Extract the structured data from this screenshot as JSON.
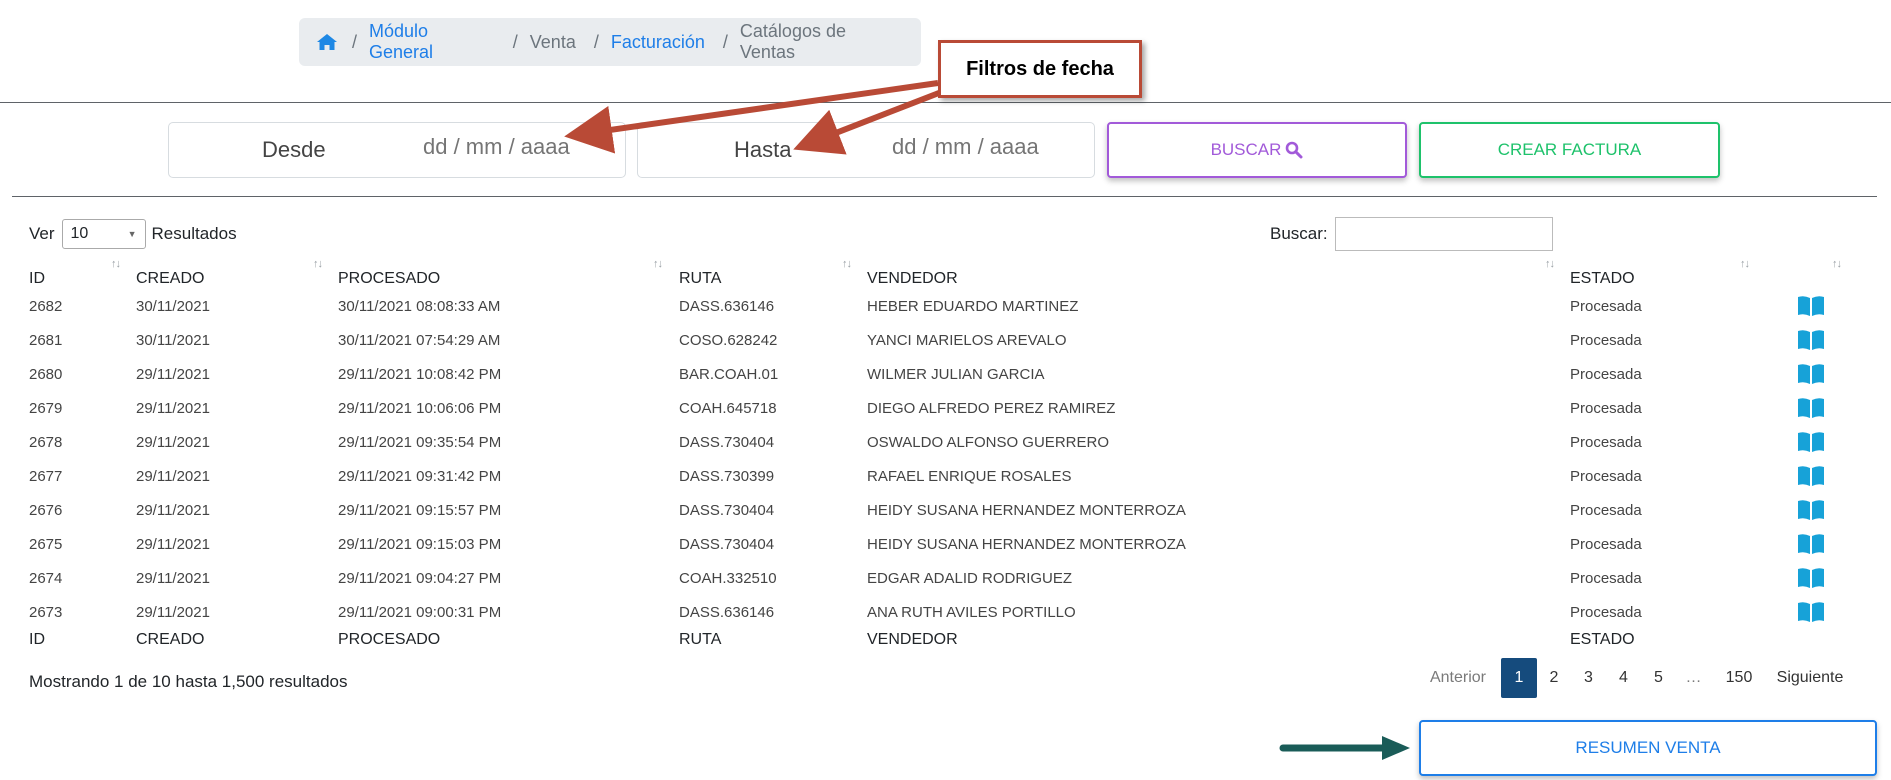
{
  "breadcrumb": {
    "items": [
      {
        "label": "Módulo General",
        "type": "link"
      },
      {
        "label": "Venta",
        "type": "muted"
      },
      {
        "label": "Facturación",
        "type": "link"
      },
      {
        "label": "Catálogos de Ventas",
        "type": "muted"
      }
    ],
    "separator": "/"
  },
  "annotation": {
    "callout_text": "Filtros de fecha",
    "color": "#b94a36",
    "arrow2_color": "#1a5c58"
  },
  "filters": {
    "desde_label": "Desde",
    "desde_placeholder": "dd / mm / aaaa",
    "hasta_label": "Hasta",
    "hasta_placeholder": "dd / mm / aaaa",
    "buscar_button": "BUSCAR",
    "crear_button": "CREAR FACTURA"
  },
  "table_controls": {
    "ver_label": "Ver",
    "page_size": "10",
    "resultados_label": "Resultados",
    "search_label": "Buscar:",
    "search_value": ""
  },
  "table": {
    "headers": [
      "ID",
      "CREADO",
      "PROCESADO",
      "RUTA",
      "VENDEDOR",
      "ESTADO"
    ],
    "rows": [
      {
        "id": "2682",
        "creado": "30/11/2021",
        "procesado": "30/11/2021 08:08:33 AM",
        "ruta": "DASS.636146",
        "vendedor": "HEBER EDUARDO MARTINEZ",
        "estado": "Procesada"
      },
      {
        "id": "2681",
        "creado": "30/11/2021",
        "procesado": "30/11/2021 07:54:29 AM",
        "ruta": "COSO.628242",
        "vendedor": "YANCI MARIELOS AREVALO",
        "estado": "Procesada"
      },
      {
        "id": "2680",
        "creado": "29/11/2021",
        "procesado": "29/11/2021 10:08:42 PM",
        "ruta": "BAR.COAH.01",
        "vendedor": "WILMER JULIAN GARCIA",
        "estado": "Procesada"
      },
      {
        "id": "2679",
        "creado": "29/11/2021",
        "procesado": "29/11/2021 10:06:06 PM",
        "ruta": "COAH.645718",
        "vendedor": "DIEGO ALFREDO PEREZ RAMIREZ",
        "estado": "Procesada"
      },
      {
        "id": "2678",
        "creado": "29/11/2021",
        "procesado": "29/11/2021 09:35:54 PM",
        "ruta": "DASS.730404",
        "vendedor": "OSWALDO ALFONSO GUERRERO",
        "estado": "Procesada"
      },
      {
        "id": "2677",
        "creado": "29/11/2021",
        "procesado": "29/11/2021 09:31:42 PM",
        "ruta": "DASS.730399",
        "vendedor": "RAFAEL ENRIQUE ROSALES",
        "estado": "Procesada"
      },
      {
        "id": "2676",
        "creado": "29/11/2021",
        "procesado": "29/11/2021 09:15:57 PM",
        "ruta": "DASS.730404",
        "vendedor": "HEIDY SUSANA HERNANDEZ MONTERROZA",
        "estado": "Procesada"
      },
      {
        "id": "2675",
        "creado": "29/11/2021",
        "procesado": "29/11/2021 09:15:03 PM",
        "ruta": "DASS.730404",
        "vendedor": "HEIDY SUSANA HERNANDEZ MONTERROZA",
        "estado": "Procesada"
      },
      {
        "id": "2674",
        "creado": "29/11/2021",
        "procesado": "29/11/2021 09:04:27 PM",
        "ruta": "COAH.332510",
        "vendedor": "EDGAR ADALID RODRIGUEZ",
        "estado": "Procesada"
      },
      {
        "id": "2673",
        "creado": "29/11/2021",
        "procesado": "29/11/2021 09:00:31 PM",
        "ruta": "DASS.636146",
        "vendedor": "ANA RUTH AVILES PORTILLO",
        "estado": "Procesada"
      }
    ],
    "row_icon": "book-icon",
    "icon_color": "#17a2d8"
  },
  "footer": {
    "info": "Mostrando 1 de 10 hasta 1,500 resultados",
    "pagination": {
      "previous": "Anterior",
      "pages": [
        "1",
        "2",
        "3",
        "4",
        "5",
        "…",
        "150"
      ],
      "current": "1",
      "next": "Siguiente"
    },
    "resumen_button": "RESUMEN VENTA"
  },
  "colors": {
    "link": "#1e7ee8",
    "buscar": "#a25ad9",
    "crear": "#1ec26b",
    "active_page": "#154b7d"
  }
}
